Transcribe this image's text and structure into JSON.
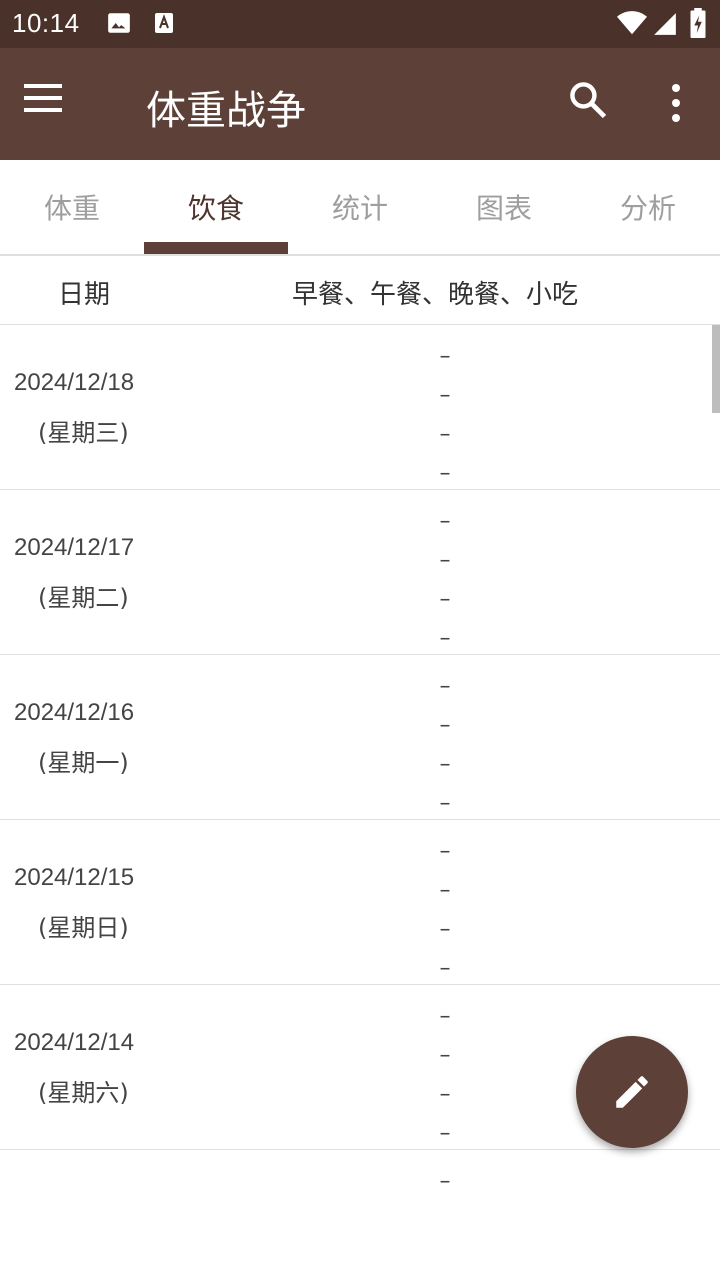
{
  "status_bar": {
    "time": "10:14",
    "icons": [
      "image-icon",
      "text-icon",
      "wifi-icon",
      "signal-icon",
      "battery-icon"
    ]
  },
  "app_bar": {
    "title": "体重战争",
    "background": "#5d4037",
    "icons": [
      "menu-icon",
      "search-icon",
      "more-vert-icon"
    ]
  },
  "tabs": [
    {
      "label": "体重",
      "active": false
    },
    {
      "label": "饮食",
      "active": true
    },
    {
      "label": "统计",
      "active": false
    },
    {
      "label": "图表",
      "active": false
    },
    {
      "label": "分析",
      "active": false
    }
  ],
  "table": {
    "header_date": "日期",
    "header_meals": "早餐、午餐、晚餐、小吃",
    "rows": [
      {
        "date": "2024/12/18",
        "weekday": "(星期三)",
        "meals": [
          "–",
          "–",
          "–",
          "–"
        ]
      },
      {
        "date": "2024/12/17",
        "weekday": "(星期二)",
        "meals": [
          "–",
          "–",
          "–",
          "–"
        ]
      },
      {
        "date": "2024/12/16",
        "weekday": "(星期一)",
        "meals": [
          "–",
          "–",
          "–",
          "–"
        ]
      },
      {
        "date": "2024/12/15",
        "weekday": "(星期日)",
        "meals": [
          "–",
          "–",
          "–",
          "–"
        ]
      },
      {
        "date": "2024/12/14",
        "weekday": "(星期六)",
        "meals": [
          "–",
          "–",
          "–",
          "–"
        ]
      },
      {
        "date": "",
        "weekday": "",
        "meals": [
          "–"
        ]
      }
    ]
  },
  "fab": {
    "icon": "edit-icon"
  }
}
